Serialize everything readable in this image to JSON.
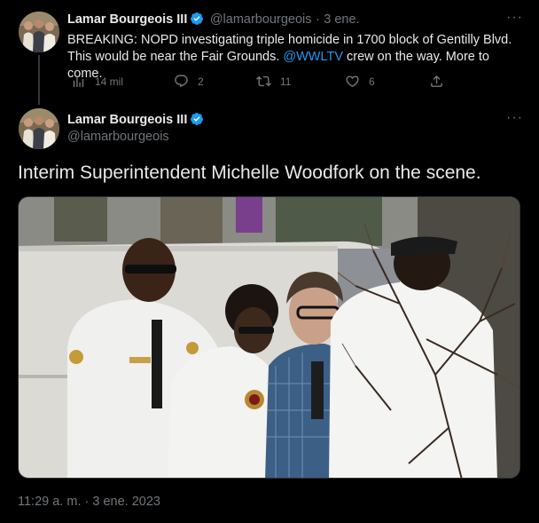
{
  "tweet1": {
    "author_name": "Lamar Bourgeois III",
    "handle": "@lamarbourgeois",
    "separator": "·",
    "time_ago": "3 ene.",
    "text_before_mention": "BREAKING: NOPD investigating triple homicide in 1700 block of Gentilly Blvd. This would be near the Fair Grounds. ",
    "mention": "@WWLTV",
    "text_after_mention": " crew on the way. More to come.",
    "more_label": "···",
    "actions": {
      "views": "14 mil",
      "replies": "2",
      "retweets": "11",
      "likes": "6"
    }
  },
  "tweet2": {
    "author_name": "Lamar Bourgeois III",
    "handle": "@lamarbourgeois",
    "more_label": "···",
    "text": "Interim Superintendent Michelle Woodfork on the scene.",
    "timestamp": "11:29 a. m. · 3 ene. 2023"
  },
  "colors": {
    "background": "#000000",
    "text": "#e7e9ea",
    "secondary": "#71767b",
    "link": "#1d9bf0",
    "verified": "#1d9bf0"
  }
}
